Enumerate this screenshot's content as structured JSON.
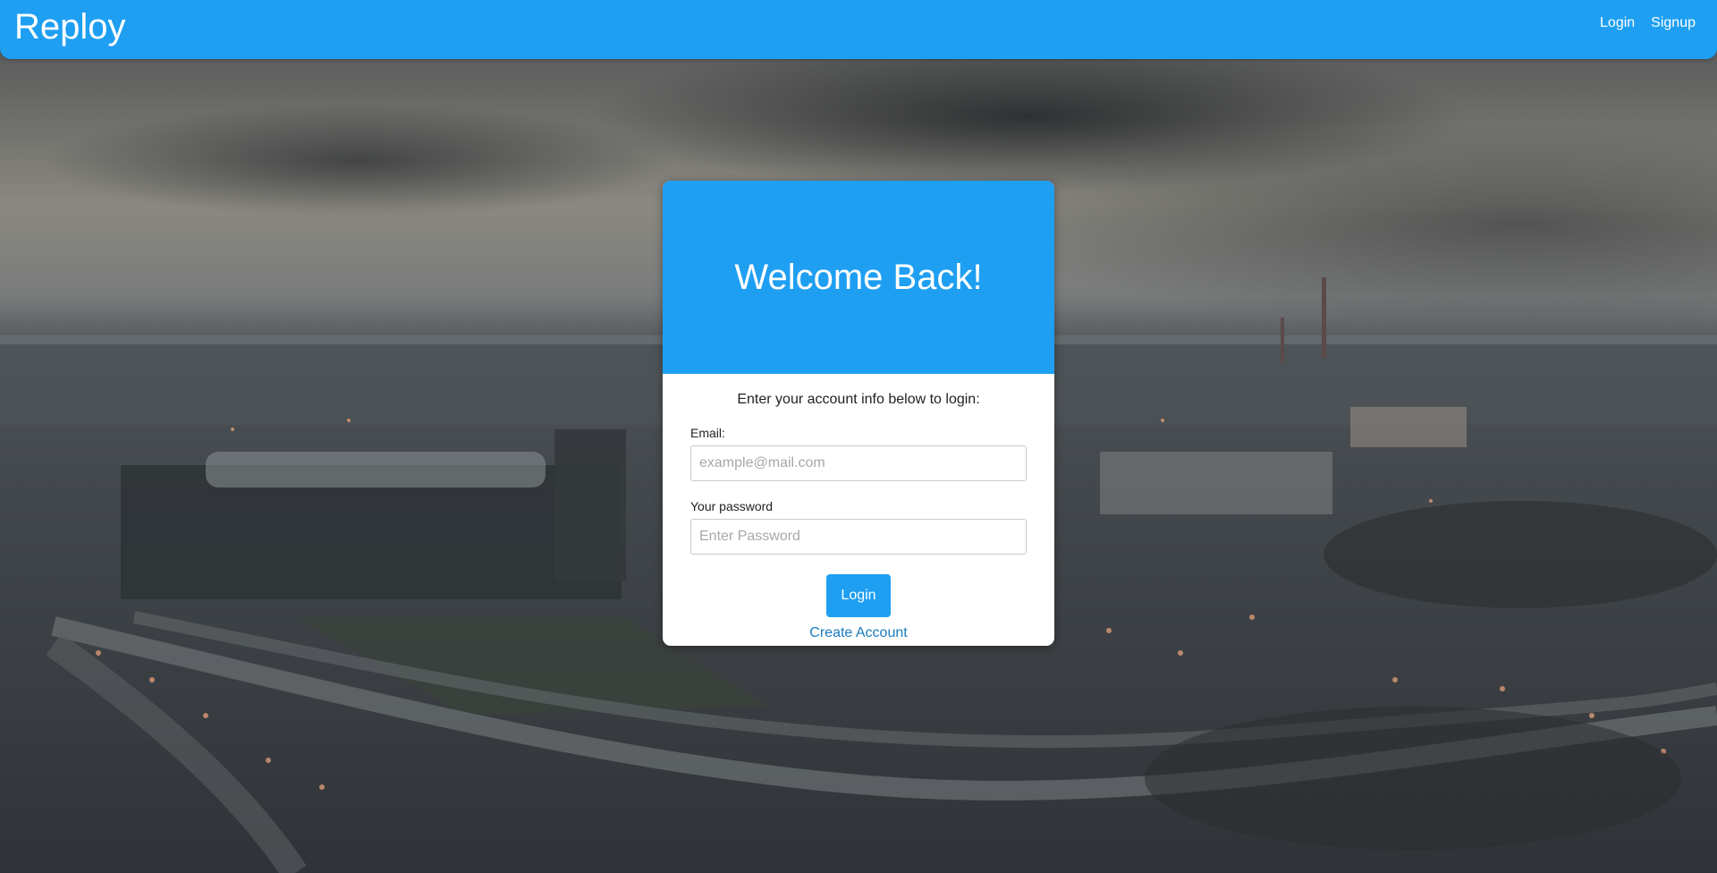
{
  "header": {
    "brand": "Reploy",
    "nav": {
      "login_label": "Login",
      "signup_label": "Signup"
    }
  },
  "login_card": {
    "title": "Welcome Back!",
    "intro": "Enter your account info below to login:",
    "email": {
      "label": "Email:",
      "placeholder": "example@mail.com",
      "value": ""
    },
    "password": {
      "label": "Your password",
      "placeholder": "Enter Password",
      "value": ""
    },
    "submit_label": "Login",
    "create_account_label": "Create Account"
  },
  "colors": {
    "accent": "#1e9ff2",
    "link": "#1a7bbf",
    "card_background": "#ffffff"
  }
}
